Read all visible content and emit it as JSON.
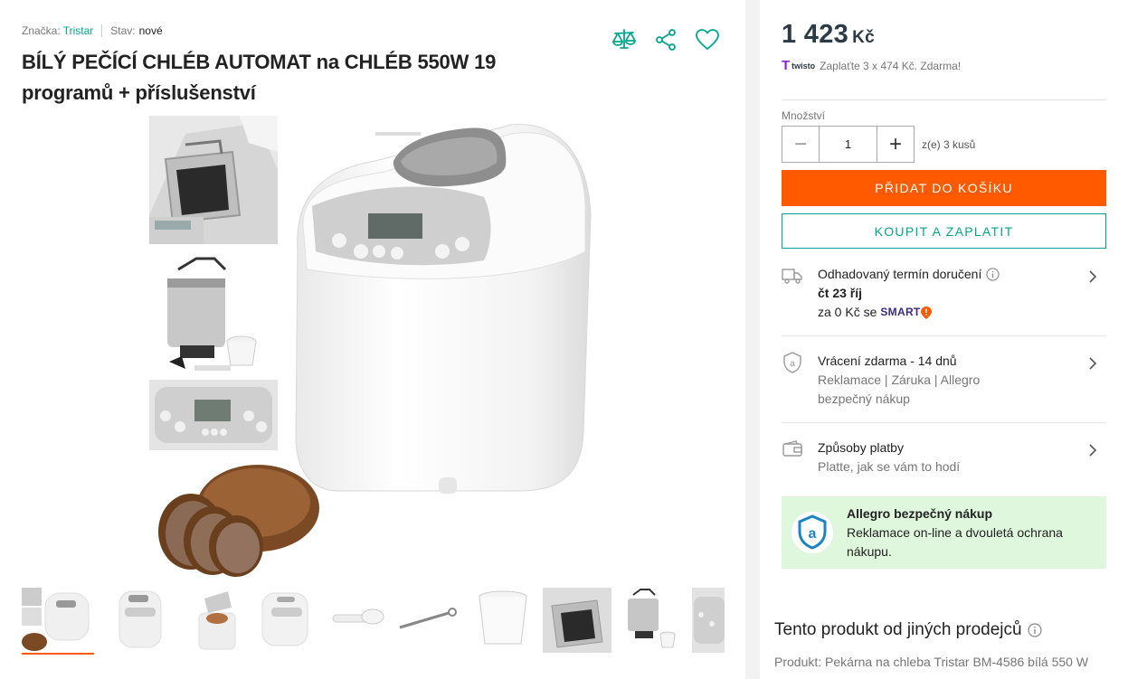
{
  "meta": {
    "brand_label": "Značka:",
    "brand_value": "Tristar",
    "condition_label": "Stav:",
    "condition_value": "nové"
  },
  "product": {
    "title": "BÍLÝ PEČÍCÍ CHLÉB AUTOMAT na CHLÉB 550W 19 programů + příslušenství"
  },
  "actions": [
    "compare-icon",
    "share-icon",
    "heart-icon"
  ],
  "gallery": {
    "thumbnails_count": 9,
    "active_index": 0
  },
  "price": {
    "amount": "1 423",
    "currency": "Kč"
  },
  "twisto": {
    "logo_t": "T",
    "logo_word": "twisto",
    "text": "Zaplaťte 3 x 474 Kč. Zdarma!"
  },
  "quantity": {
    "label": "Množství",
    "value": "1",
    "minus": "−",
    "plus": "+",
    "of_text": "z(e) 3 kusů"
  },
  "buttons": {
    "add_to_cart": "PŘIDAT DO KOŠÍKU",
    "buy_now": "KOUPIT A ZAPLATIT"
  },
  "delivery": {
    "title": "Odhadovaný termín doručení",
    "date": "čt 23 říj",
    "price_prefix": "za 0 Kč se",
    "smart": "SMART"
  },
  "returns": {
    "title": "Vrácení zdarma - 14 dnů",
    "line1": "Reklamace | Záruka | Allegro",
    "line2": "bezpečný nákup"
  },
  "payment": {
    "title": "Způsoby platby",
    "subtitle": "Platte, jak se vám to hodí"
  },
  "safe": {
    "title": "Allegro bezpečný nákup",
    "text": "Reklamace on-line a dvouletá ochrana nákupu."
  },
  "other_sellers": {
    "title": "Tento produkt od jiných prodejců",
    "desc": "Produkt: Pekárna na chleba Tristar BM-4586 bílá 550 W"
  }
}
